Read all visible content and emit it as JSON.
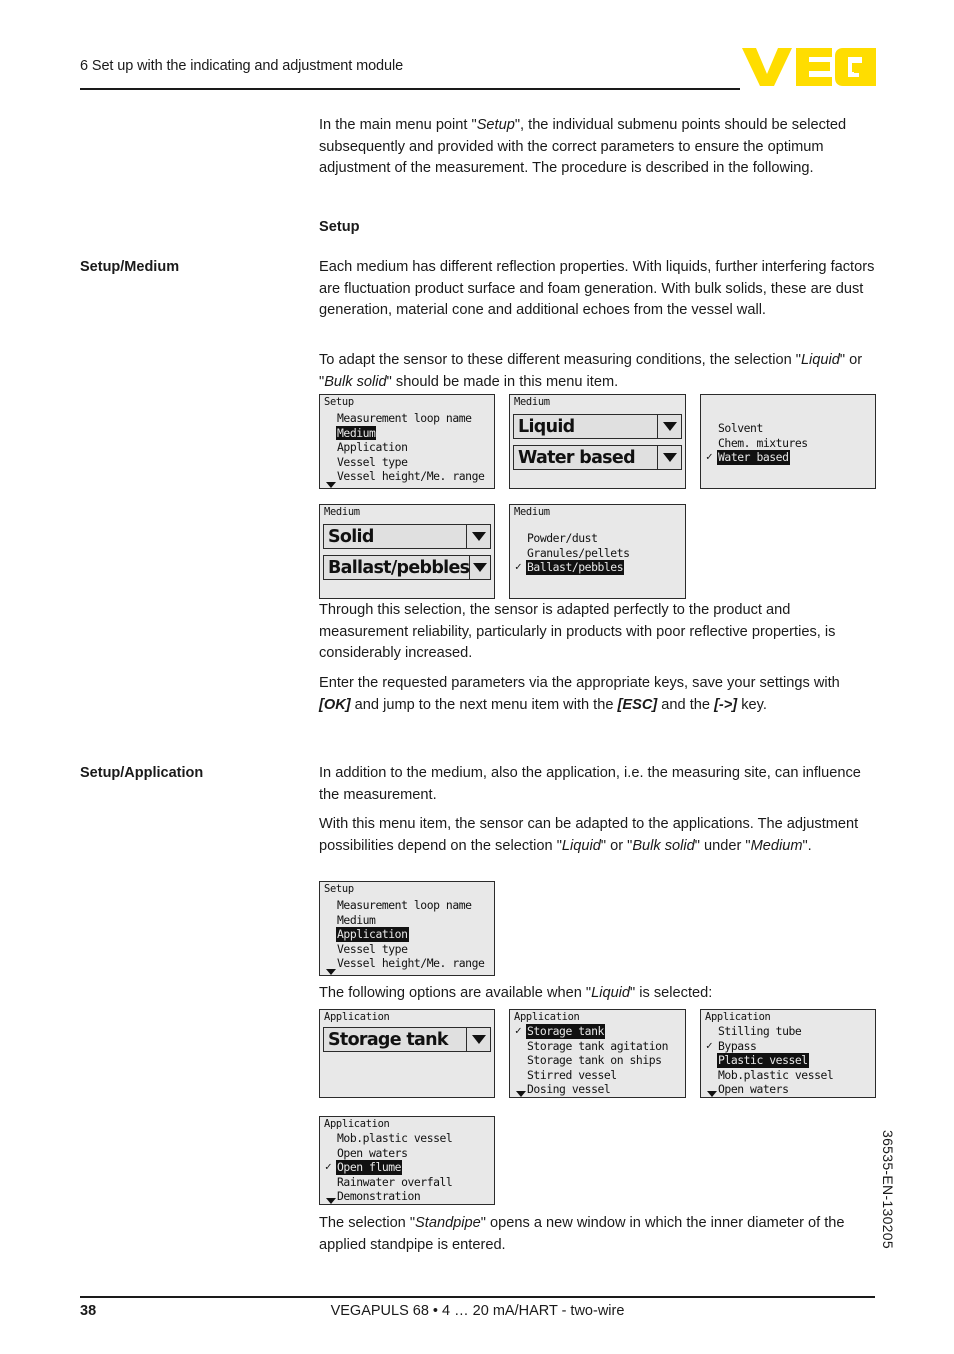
{
  "header": {
    "chapter_title": "6 Set up with the indicating and adjustment module",
    "logo_text": "VEGA",
    "logo_color": "#FFDD00"
  },
  "footer": {
    "page_number": "38",
    "document_line": "VEGAPULS 68 • 4 … 20 mA/HART - two-wire",
    "side_code": "36535-EN-130205"
  },
  "marginals": {
    "setup_medium": "Setup/Medium",
    "setup_application": "Setup/Application"
  },
  "body": {
    "intro_p1_a": "In the main menu point \"",
    "intro_p1_it": "Setup",
    "intro_p1_b": "\", the individual submenu points should be selected subsequently and provided with the correct parameters to ensure the optimum adjustment of the measurement. The procedure is described in the following.",
    "setup_heading": "Setup",
    "medium_p1": "Each medium has different reflection properties. With liquids, further interfering factors are fluctuation product surface and foam generation. With bulk solids, these are dust generation, material cone and additional echoes from the vessel wall.",
    "medium_p2_a": "To adapt the sensor to these different measuring conditions, the selection \"",
    "medium_p2_it1": "Liquid",
    "medium_p2_b": "\" or \"",
    "medium_p2_it2": "Bulk solid",
    "medium_p2_c": "\" should be made in this menu item.",
    "medium_p3": "Through this selection, the sensor is adapted perfectly to the product and measurement reliability, particularly in products with poor reflective properties, is considerably increased.",
    "medium_p4_a": "Enter the requested parameters via the appropriate keys, save your settings with ",
    "medium_p4_ok": "[OK]",
    "medium_p4_b": " and jump to the next menu item with the ",
    "medium_p4_esc": "[ESC]",
    "medium_p4_c": " and the ",
    "medium_p4_arrow": "[->]",
    "medium_p4_d": " key.",
    "app_p1": "In addition to the medium, also the application, i.e. the measuring site, can influence the measurement.",
    "app_p2_a": "With this menu item, the sensor can be adapted to the applications. The adjustment possibilities depend on the selection \"",
    "app_p2_it1": "Liquid",
    "app_p2_b": "\" or \"",
    "app_p2_it2": "Bulk solid",
    "app_p2_c": "\" under \"",
    "app_p2_it3": "Medium",
    "app_p2_d": "\".",
    "app_p3_a": "The following options are available when \"",
    "app_p3_it": "Liquid",
    "app_p3_b": "\" is selected:",
    "app_p4_a": "The selection \"",
    "app_p4_it": "Standpipe",
    "app_p4_b": "\" opens a new window in which the inner diameter of the applied standpipe is entered."
  },
  "displays": {
    "setup_medium_menu": {
      "title": "Setup",
      "rows": [
        {
          "label": "Measurement loop name",
          "selected": false,
          "check": false
        },
        {
          "label": "Medium",
          "selected": true,
          "check": false
        },
        {
          "label": "Application",
          "selected": false,
          "check": false
        },
        {
          "label": "Vessel type",
          "selected": false,
          "check": false
        },
        {
          "label": "Vessel height/Me. range",
          "selected": false,
          "check": false
        }
      ],
      "more_indicator": true
    },
    "medium_liquid_fields": {
      "title": "Medium",
      "fields": [
        {
          "value": "Liquid"
        },
        {
          "value": "Water based"
        }
      ]
    },
    "medium_liquid_options": {
      "title": "",
      "rows": [
        {
          "label": "Solvent",
          "selected": false,
          "check": false
        },
        {
          "label": "Chem. mixtures",
          "selected": false,
          "check": false
        },
        {
          "label": "Water based",
          "selected": true,
          "check": true
        }
      ],
      "more_indicator": false
    },
    "medium_solid_fields": {
      "title": "Medium",
      "fields": [
        {
          "value": "Solid"
        },
        {
          "value": "Ballast/pebbles"
        }
      ]
    },
    "medium_solid_options": {
      "title": "Medium",
      "rows": [
        {
          "label": "Powder/dust",
          "selected": false,
          "check": false
        },
        {
          "label": "Granules/pellets",
          "selected": false,
          "check": false
        },
        {
          "label": "Ballast/pebbles",
          "selected": true,
          "check": true
        }
      ],
      "more_indicator": false
    },
    "setup_application_menu": {
      "title": "Setup",
      "rows": [
        {
          "label": "Measurement loop name",
          "selected": false,
          "check": false
        },
        {
          "label": "Medium",
          "selected": false,
          "check": false
        },
        {
          "label": "Application",
          "selected": true,
          "check": false
        },
        {
          "label": "Vessel type",
          "selected": false,
          "check": false
        },
        {
          "label": "Vessel height/Me. range",
          "selected": false,
          "check": false
        }
      ],
      "more_indicator": true
    },
    "application_field": {
      "title": "Application",
      "fields": [
        {
          "value": "Storage tank"
        }
      ]
    },
    "application_options_1": {
      "title": "Application",
      "rows": [
        {
          "label": "Storage tank",
          "selected": true,
          "check": true
        },
        {
          "label": "Storage tank agitation",
          "selected": false,
          "check": false
        },
        {
          "label": "Storage tank on ships",
          "selected": false,
          "check": false
        },
        {
          "label": "Stirred vessel",
          "selected": false,
          "check": false
        },
        {
          "label": "Dosing vessel",
          "selected": false,
          "check": false
        }
      ],
      "more_indicator": true
    },
    "application_options_2": {
      "title": "Application",
      "rows": [
        {
          "label": "Stilling tube",
          "selected": false,
          "check": false
        },
        {
          "label": "Bypass",
          "selected": false,
          "check": true
        },
        {
          "label": "Plastic vessel",
          "selected": true,
          "check": false
        },
        {
          "label": "Mob.plastic vessel",
          "selected": false,
          "check": false
        },
        {
          "label": "Open waters",
          "selected": false,
          "check": false
        }
      ],
      "more_indicator": true
    },
    "application_options_3": {
      "title": "Application",
      "rows": [
        {
          "label": "Mob.plastic vessel",
          "selected": false,
          "check": false
        },
        {
          "label": "Open waters",
          "selected": false,
          "check": false
        },
        {
          "label": "Open flume",
          "selected": true,
          "check": true
        },
        {
          "label": "Rainwater overfall",
          "selected": false,
          "check": false
        },
        {
          "label": "Demonstration",
          "selected": false,
          "check": false
        }
      ],
      "more_indicator": true
    }
  }
}
